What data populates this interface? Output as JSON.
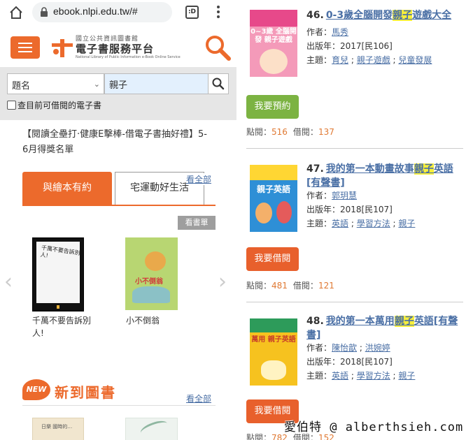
{
  "browser": {
    "url": "ebook.nlpi.edu.tw/#",
    "tabs_count": ":D"
  },
  "site": {
    "logo_line1": "國立公共資訊圖書館",
    "logo_line2": "電子書服務平台",
    "logo_line3": "National Library of Public Information e-Book Online Service"
  },
  "search": {
    "field_selected": "題名",
    "query": "親子",
    "available_only_label": "查目前可借閱的電子書"
  },
  "announcement": "【閱讀全壘打‧健康E擊棒-借電子書抽好禮】5-6月得獎名單",
  "tabs": {
    "active": "與繪本有約",
    "inactive": "宅運動好生活",
    "see_all": "看全部"
  },
  "booklist_button": "看書單",
  "carousel": {
    "prev": "‹",
    "next": "›",
    "books": [
      {
        "title": "千萬不要告訴別人!",
        "cover_text": "千萬不要告訴別人!"
      },
      {
        "title": "小不倒翁",
        "cover_text": "小不倒翁"
      }
    ]
  },
  "new_arrivals": {
    "badge": "NEW",
    "heading": "新到圖書",
    "see_all": "看全部",
    "cover_text": "日樂 國時的…"
  },
  "results": [
    {
      "number": "46.",
      "title_before": "0-3歲全腦開發",
      "title_highlight": "親子",
      "title_after": "遊戲大全",
      "author_label": "作者：",
      "authors": [
        "馬秀"
      ],
      "year_label": "出版年：",
      "year": "2017[民106]",
      "subject_label": "主題：",
      "subjects": [
        "育兒",
        "親子遊戲",
        "兒童發展"
      ],
      "action": "我要預約",
      "action_color": "#7cb342",
      "views_label": "點閱：",
      "views": "516",
      "borrows_label": "借閱：",
      "borrows": "137",
      "cover_text": "0~3歲 全腦開發 親子遊戲"
    },
    {
      "number": "47.",
      "title_before": "我的第一本動畫故事",
      "title_highlight": "親子",
      "title_after": "英語[有聲書]",
      "author_label": "作者：",
      "authors": [
        "郭玥慧"
      ],
      "year_label": "出版年：",
      "year": "2018[民107]",
      "subject_label": "主題：",
      "subjects": [
        "英語",
        "學習方法",
        "親子"
      ],
      "action": "我要借閱",
      "action_color": "#e8602c",
      "views_label": "點閱：",
      "views": "481",
      "borrows_label": "借閱：",
      "borrows": "121",
      "cover_text": "親子英語"
    },
    {
      "number": "48.",
      "title_before": "我的第一本萬用",
      "title_highlight": "親子",
      "title_after": "英語[有聲書]",
      "author_label": "作者：",
      "authors": [
        "陳怡歆",
        "洪婉婷"
      ],
      "year_label": "出版年：",
      "year": "2018[民107]",
      "subject_label": "主題：",
      "subjects": [
        "英語",
        "學習方法",
        "親子"
      ],
      "action": "我要借閱",
      "action_color": "#e8602c",
      "views_label": "點閱：",
      "views": "782",
      "borrows_label": "借閱：",
      "borrows": "152",
      "cover_text": "萬用 親子英語"
    }
  ],
  "watermark": "愛伯特 @ alberthsieh.com",
  "colors": {
    "accent": "#ec6a2c",
    "link": "#4a6fa5",
    "highlight": "#f7ef3b",
    "reserve_button": "#7cb342",
    "borrow_button": "#e8602c"
  }
}
